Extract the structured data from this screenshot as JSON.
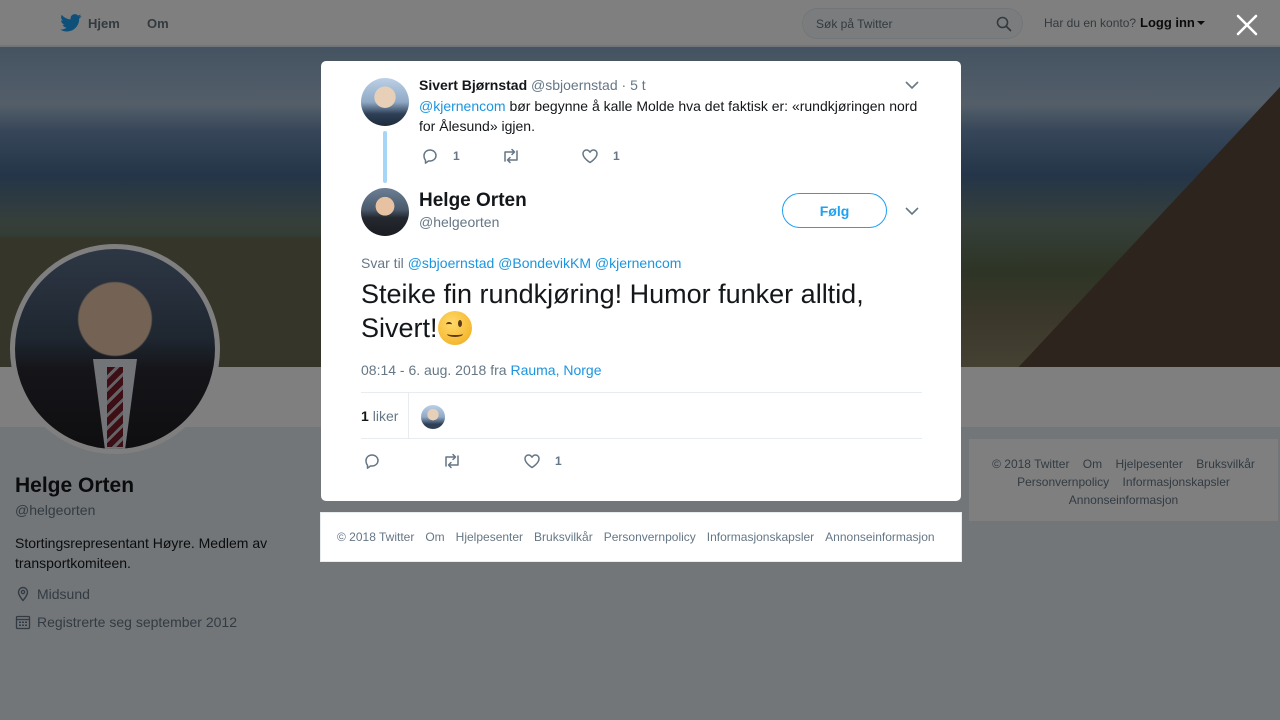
{
  "topbar": {
    "home_label": "Hjem",
    "about_label": "Om",
    "search_placeholder": "Søk på Twitter",
    "login_prompt": "Har du en konto?",
    "login_link": "Logg inn"
  },
  "profile": {
    "name": "Helge Orten",
    "handle": "@helgeorten",
    "bio": "Stortingsrepresentant Høyre. Medlem av transportkomiteen.",
    "location": "Midsund",
    "joined": "Registrerte seg september 2012"
  },
  "side_footer": {
    "line1": [
      "© 2018 Twitter",
      "Om",
      "Hjelpesenter",
      "Bruksvilkår"
    ],
    "line2": [
      "Personvernpolicy",
      "Informasjonskapsler"
    ],
    "line3": [
      "Annonseinformasjon"
    ]
  },
  "parent_tweet": {
    "name": "Sivert Bjørnstad",
    "handle": "@sbjoernstad",
    "time": "· 5 t",
    "mention": "@kjernencom",
    "text": " bør begynne å kalle Molde hva det faktisk er: «rundkjøringen nord for Ålesund» igjen.",
    "reply_count": "1",
    "like_count": "1"
  },
  "main_tweet": {
    "name": "Helge Orten",
    "handle": "@helgeorten",
    "follow_label": "Følg",
    "reply_to_label": "Svar til",
    "reply_to_users": [
      "@sbjoernstad",
      "@BondevikKM",
      "@kjernencom"
    ],
    "text": "Steike fin rundkjøring! Humor funker alltid, Sivert!",
    "timestamp": "08:14 - 6. aug. 2018 fra",
    "location": "Rauma, Norge",
    "likes_count": "1",
    "likes_label": "liker",
    "like_count": "1"
  },
  "modal_footer": {
    "links": [
      "© 2018 Twitter",
      "Om",
      "Hjelpesenter",
      "Bruksvilkår",
      "Personvernpolicy",
      "Informasjonskapsler",
      "Annonseinformasjon"
    ]
  },
  "colors": {
    "accent": "#1da1f2",
    "link": "#1b95e0",
    "muted": "#657786",
    "thread_line": "#a5d6f8"
  }
}
